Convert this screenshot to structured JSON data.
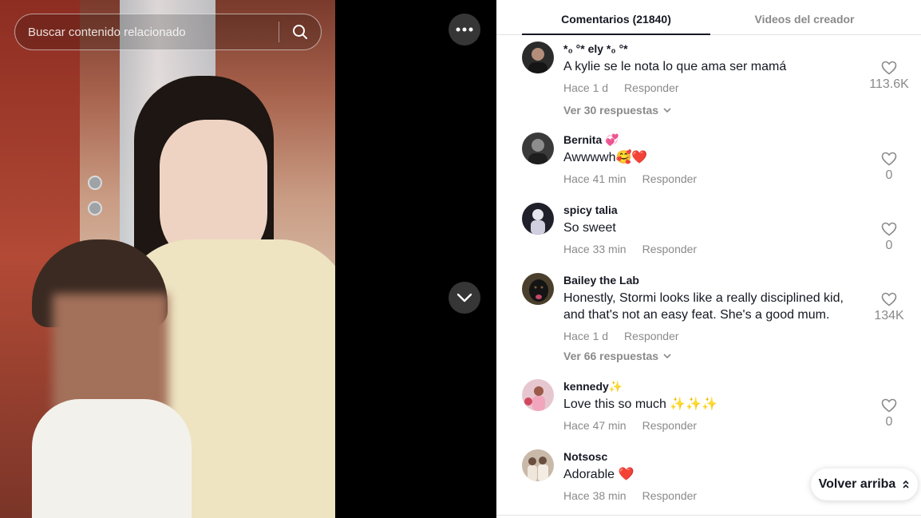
{
  "search": {
    "placeholder": "Buscar contenido relacionado"
  },
  "tabs": [
    {
      "label": "Comentarios (21840)",
      "active": true
    },
    {
      "label": "Videos del creador",
      "active": false
    }
  ],
  "comments": [
    {
      "user": "*₀ °* ely *₀ °*",
      "text": "A kylie se le nota lo que ama ser mamá",
      "time": "Hace 1 d",
      "reply": "Responder",
      "likes": "113.6K",
      "more": "Ver 30 respuestas",
      "avatar_color": "#2b2b2b"
    },
    {
      "user": "Bernita 💞",
      "text": "Awwwwh🥰❤️",
      "time": "Hace 41 min",
      "reply": "Responder",
      "likes": "0",
      "avatar_color": "#3a3a3a"
    },
    {
      "user": "spicy talia",
      "text": "So sweet",
      "time": "Hace 33 min",
      "reply": "Responder",
      "likes": "0",
      "avatar_color": "#20202a"
    },
    {
      "user": "Bailey the Lab",
      "text": "Honestly, Stormi looks like a really disciplined kid, and that's not an easy feat. She's a good mum.",
      "time": "Hace 1 d",
      "reply": "Responder",
      "likes": "134K",
      "more": "Ver 66 respuestas",
      "avatar_color": "#4a3f2c"
    },
    {
      "user": "kennedy✨",
      "text": "Love this so much ✨✨✨",
      "time": "Hace 47 min",
      "reply": "Responder",
      "likes": "0",
      "avatar_color": "#e7c7cf"
    },
    {
      "user": "Notsosc",
      "text": "Adorable ❤️",
      "time": "Hace 38 min",
      "reply": "Responder",
      "likes": "",
      "avatar_color": "#c9b9a9"
    }
  ],
  "back_to_top": "Volver arriba",
  "colors": {
    "text": "#161823",
    "muted": "#8a8a8a",
    "divider": "#e3e3e3"
  }
}
